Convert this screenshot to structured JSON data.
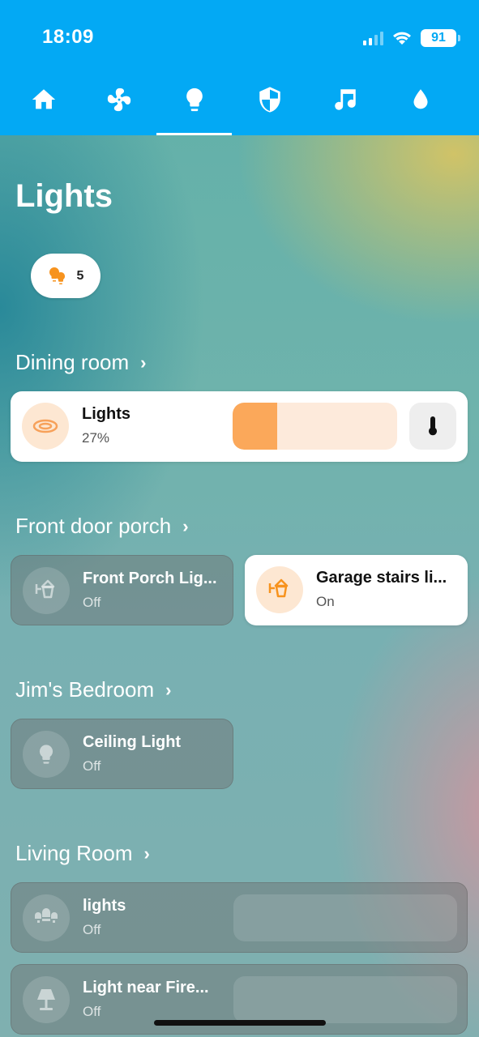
{
  "status_bar": {
    "time": "18:09",
    "battery": "91"
  },
  "tabs": [
    {
      "icon": "home-icon"
    },
    {
      "icon": "fan-icon"
    },
    {
      "icon": "lightbulb-icon",
      "active": true
    },
    {
      "icon": "shield-icon"
    },
    {
      "icon": "music-note-icon"
    },
    {
      "icon": "water-drop-icon"
    }
  ],
  "page": {
    "title": "Lights"
  },
  "chip": {
    "icon": "lightbulbs-icon",
    "count": "5"
  },
  "colors": {
    "header": "#03a9f4",
    "accent": "#fba85a",
    "accent_light": "#fdeadb",
    "lamp_on": "#f7931e"
  },
  "sections": [
    {
      "title": "Dining room",
      "cards": [
        {
          "name": "Lights",
          "state": "27%",
          "on": true,
          "brightness_percent": 27,
          "icon": "ceiling-light-round-icon"
        }
      ]
    },
    {
      "title": "Front door porch",
      "cards": [
        {
          "name": "Front Porch Lig...",
          "state": "Off",
          "on": false,
          "icon": "outdoor-lamp-icon"
        },
        {
          "name": "Garage stairs li...",
          "state": "On",
          "on": true,
          "icon": "outdoor-lamp-icon"
        }
      ]
    },
    {
      "title": "Jim's Bedroom",
      "cards": [
        {
          "name": "Ceiling Light",
          "state": "Off",
          "on": false,
          "icon": "lightbulb-icon"
        }
      ]
    },
    {
      "title": "Living Room",
      "cards": [
        {
          "name": "lights",
          "state": "Off",
          "on": false,
          "icon": "chandelier-icon"
        },
        {
          "name": "Light near Fire...",
          "state": "Off",
          "on": false,
          "icon": "table-lamp-icon"
        }
      ]
    }
  ]
}
